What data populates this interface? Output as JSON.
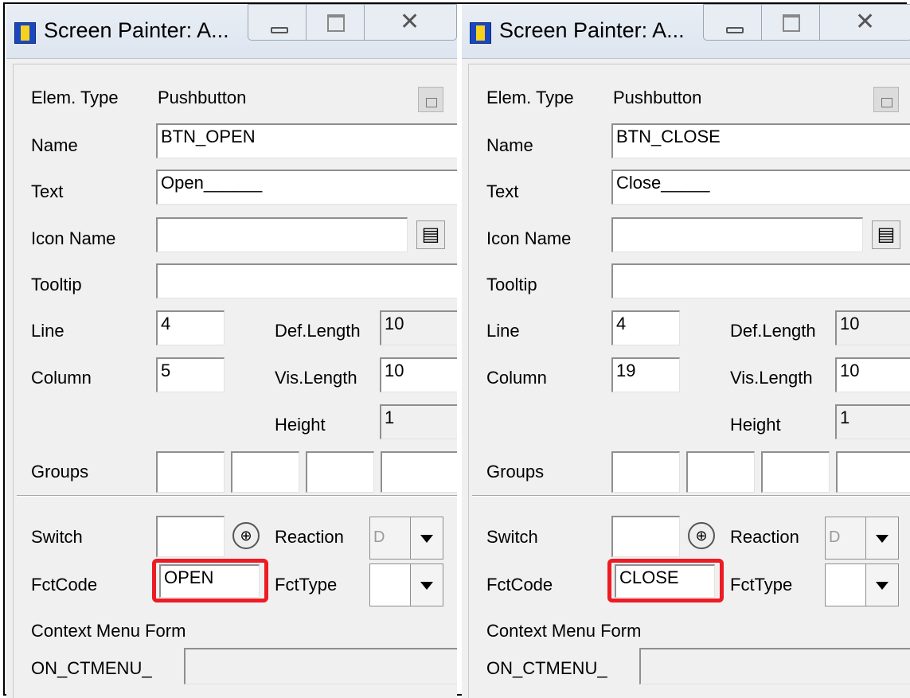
{
  "windows": [
    {
      "title": "Screen Painter: A...",
      "labels": {
        "elem_type": "Elem. Type",
        "name": "Name",
        "text": "Text",
        "icon_name": "Icon Name",
        "tooltip": "Tooltip",
        "line": "Line",
        "column": "Column",
        "def_length": "Def.Length",
        "vis_length": "Vis.Length",
        "height": "Height",
        "groups": "Groups",
        "switch": "Switch",
        "reaction": "Reaction",
        "fctcode": "FctCode",
        "fcttype": "FctType",
        "context_menu_form": "Context Menu Form",
        "on_ctmenu": "ON_CTMENU_"
      },
      "values": {
        "elem_type": "Pushbutton",
        "name": "BTN_OPEN",
        "text": "Open______",
        "icon_name": "",
        "tooltip": "",
        "line": "4",
        "column": "5",
        "def_length": "10",
        "vis_length": "10",
        "height": "1",
        "reaction": "D",
        "fctcode": "OPEN",
        "fcttype": "",
        "context_menu": ""
      }
    },
    {
      "title": "Screen Painter: A...",
      "labels": {
        "elem_type": "Elem. Type",
        "name": "Name",
        "text": "Text",
        "icon_name": "Icon Name",
        "tooltip": "Tooltip",
        "line": "Line",
        "column": "Column",
        "def_length": "Def.Length",
        "vis_length": "Vis.Length",
        "height": "Height",
        "groups": "Groups",
        "switch": "Switch",
        "reaction": "Reaction",
        "fctcode": "FctCode",
        "fcttype": "FctType",
        "context_menu_form": "Context Menu Form",
        "on_ctmenu": "ON_CTMENU_"
      },
      "values": {
        "elem_type": "Pushbutton",
        "name": "BTN_CLOSE",
        "text": "Close_____",
        "icon_name": "",
        "tooltip": "",
        "line": "4",
        "column": "19",
        "def_length": "10",
        "vis_length": "10",
        "height": "1",
        "reaction": "D",
        "fctcode": "CLOSE",
        "fcttype": "",
        "context_menu": ""
      }
    }
  ],
  "highlight_color": "#ec1c24",
  "icons": [
    "app-icon",
    "minimize-icon",
    "maximize-icon",
    "close-icon",
    "attributes-icon",
    "icon-list-icon",
    "switch-icon",
    "dropdown-arrow-icon"
  ]
}
